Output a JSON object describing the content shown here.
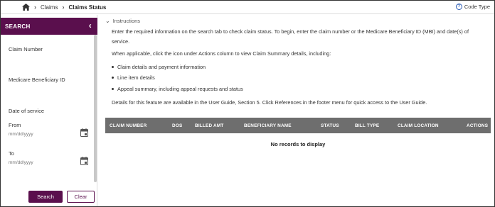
{
  "breadcrumb": {
    "items": [
      "Claims",
      "Claims Status"
    ]
  },
  "header": {
    "code_type": "Code Type"
  },
  "sidebar": {
    "title": "SEARCH",
    "claim_number_label": "Claim Number",
    "mbi_label": "Medicare Beneficiary ID",
    "dos_label": "Date of service",
    "from_label": "From",
    "from_placeholder": "mm/dd/yyyy",
    "to_label": "To",
    "to_placeholder": "mm/dd/yyyy",
    "search_button": "Search",
    "clear_button": "Clear"
  },
  "instructions": {
    "toggle_label": "Instructions",
    "line1": "Enter the required information on the search tab to check claim status. To begin, enter the claim number or the Medicare Beneficiary ID (MBI) and date(s) of",
    "line1b": "service.",
    "line2": "When applicable, click the icon under Actions column to view Claim Summary details, including:",
    "bullets": [
      "Claim details and payment information",
      "Line item details",
      "Appeal summary, including appeal requests and status"
    ],
    "line3": "Details for this feature are available in the User Guide, Section 5. Click References in the footer menu for quick access to the User Guide."
  },
  "table": {
    "columns": [
      "CLAIM NUMBER",
      "DOS",
      "BILLED AMT",
      "BENEFICIARY NAME",
      "STATUS",
      "BILL TYPE",
      "CLAIM LOCATION",
      "ACTIONS"
    ],
    "empty_message": "No records to display"
  },
  "colors": {
    "brand": "#5a0f4d",
    "table_header": "#6e6e6e"
  }
}
